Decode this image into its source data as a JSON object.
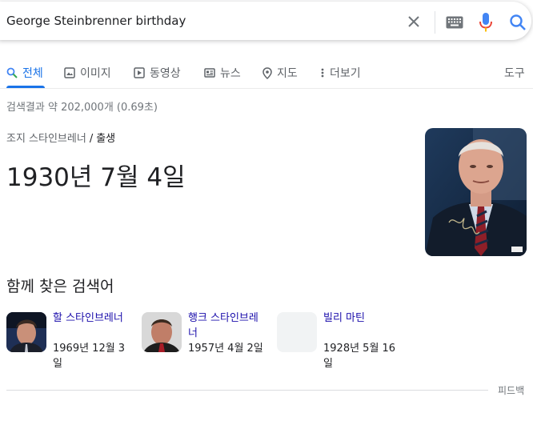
{
  "search": {
    "query": "George Steinbrenner birthday"
  },
  "tabs": [
    {
      "label": "전체",
      "icon": "search-icon"
    },
    {
      "label": "이미지",
      "icon": "image-icon"
    },
    {
      "label": "동영상",
      "icon": "video-icon"
    },
    {
      "label": "뉴스",
      "icon": "news-icon"
    },
    {
      "label": "지도",
      "icon": "map-pin-icon"
    },
    {
      "label": "더보기",
      "icon": "more-vert-icon"
    }
  ],
  "tools_label": "도구",
  "stats": "검색결과 약 202,000개 (0.69초)",
  "knowledge": {
    "entity": "조지 스타인브레너",
    "separator": "/",
    "attribute": "출생",
    "answer": "1930년 7월 4일"
  },
  "related": {
    "title": "함께 찾은 검색어",
    "items": [
      {
        "name": "할 스타인브레너",
        "date": "1969년 12월 3일"
      },
      {
        "name": "행크 스타인브레너",
        "date": "1957년 4월 2일"
      },
      {
        "name": "빌리 마틴",
        "date": "1928년 5월 16일"
      }
    ]
  },
  "feedback_label": "피드백",
  "colors": {
    "accent": "#1a73e8",
    "link": "#1a0dab",
    "text": "#202124",
    "muted": "#70757a"
  }
}
